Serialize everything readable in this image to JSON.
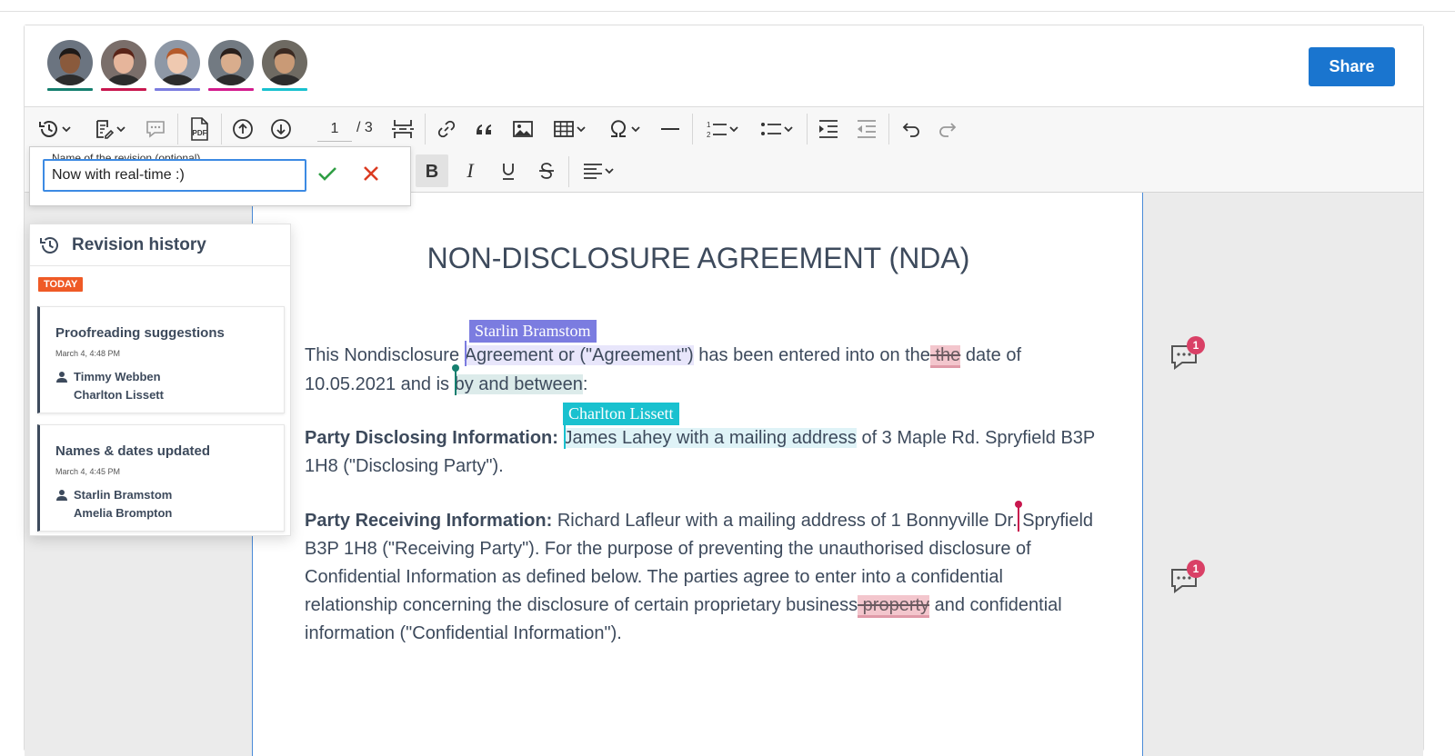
{
  "header": {
    "collaborators": [
      {
        "name": "collaborator-1",
        "underline": "#157f6f",
        "skin": "#8a5a3c",
        "hair": "#1e1a18",
        "bg": "#6b7480"
      },
      {
        "name": "collaborator-2",
        "underline": "#c8174e",
        "skin": "#e6b59b",
        "hair": "#5a2418",
        "bg": "#7a6e6a"
      },
      {
        "name": "collaborator-3",
        "underline": "#7b7ce0",
        "skin": "#efc9b0",
        "hair": "#b55a2a",
        "bg": "#8e98a6"
      },
      {
        "name": "collaborator-4",
        "underline": "#d31b8d",
        "skin": "#d9ad8d",
        "hair": "#2a201c",
        "bg": "#727a82"
      },
      {
        "name": "collaborator-5",
        "underline": "#19c1cf",
        "skin": "#c99a76",
        "hair": "#3b2a22",
        "bg": "#6e6a62"
      }
    ],
    "share_label": "Share"
  },
  "toolbar": {
    "page_current": "1",
    "page_total": "/ 3"
  },
  "revision_name": {
    "legend": "Name of the revision (optional)",
    "value": "Now with real-time :)"
  },
  "revision_history": {
    "title": "Revision history",
    "today_badge": "TODAY",
    "revisions": [
      {
        "name": "Proofreading suggestions",
        "date": "March 4, 4:48 PM",
        "authors": [
          "Timmy Webben",
          "Charlton Lissett"
        ]
      },
      {
        "name": "Names & dates updated",
        "date": "March 4, 4:45 PM",
        "authors": [
          "Starlin Bramstom",
          "Amelia Brompton"
        ]
      }
    ]
  },
  "document": {
    "title": "NON-DISCLOSURE AGREEMENT (NDA)",
    "users": {
      "starlin": {
        "name": "Starlin Bramstom",
        "color": "#7b7ce0"
      },
      "charlton": {
        "name": "Charlton Lissett",
        "color": "#19c1cf"
      },
      "green": {
        "color": "#157f6f"
      },
      "red": {
        "color": "#c8174e"
      }
    },
    "p1": {
      "t1": "This Nondisclosure ",
      "t2": "Agreement or (\"Agreement\")",
      "t3": " has been entered into on the",
      "t4": " the",
      "t5": " date of 10.05.2021 and is ",
      "t6": "by and between",
      "t7": ":"
    },
    "p2": {
      "label": "Party Disclosing Information:",
      "t1": " ",
      "t2": "James Lahey with a mailing address",
      "t3": " of 3 Maple Rd. Spryfield B3P 1H8  (\"Disclosing Party\")."
    },
    "p3": {
      "label": "Party Receiving Information:",
      "t1": "  Richard Lafleur with a mailing address of 1 Bonnyville Dr.",
      "t2": " Spryfield B3P 1H8 (\"Receiving Party\"). For the purpose of preventing the unauthorised disclosure of Confidential Information as defined below. The parties agree to enter into a confidential relationship concerning the disclosure of certain proprietary business",
      "t3": " property",
      "t4": " and confidential information (\"Confidential Information\")."
    },
    "comments": [
      {
        "count": "1"
      },
      {
        "count": "1"
      }
    ]
  },
  "colors": {
    "accent": "#1a75cf",
    "text": "#3d4a5c",
    "today": "#ef5a26",
    "badge": "#d94066"
  }
}
